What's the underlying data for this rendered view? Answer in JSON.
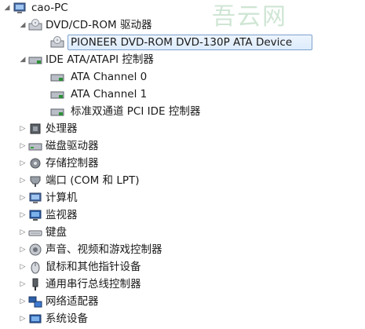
{
  "watermark": "吾云网",
  "tree": {
    "root": "cao-PC",
    "dvd_category": "DVD/CD-ROM 驱动器",
    "dvd_device": "PIONEER DVD-ROM DVD-130P ATA Device",
    "ide_category": "IDE ATA/ATAPI 控制器",
    "ide_ch0": "ATA Channel 0",
    "ide_ch1": "ATA Channel 1",
    "ide_pci": "标准双通道 PCI IDE 控制器",
    "cpu": "处理器",
    "disk": "磁盘驱动器",
    "storage": "存储控制器",
    "ports": "端口 (COM 和 LPT)",
    "computer": "计算机",
    "monitor": "监视器",
    "keyboard": "键盘",
    "audio": "声音、视频和游戏控制器",
    "mouse": "鼠标和其他指针设备",
    "usb": "通用串行总线控制器",
    "network": "网络适配器",
    "system": "系统设备"
  },
  "colors": {
    "selection_border": "#7da2ce",
    "selection_fill": "#dcebfc",
    "watermark": "#cfe6d4"
  }
}
